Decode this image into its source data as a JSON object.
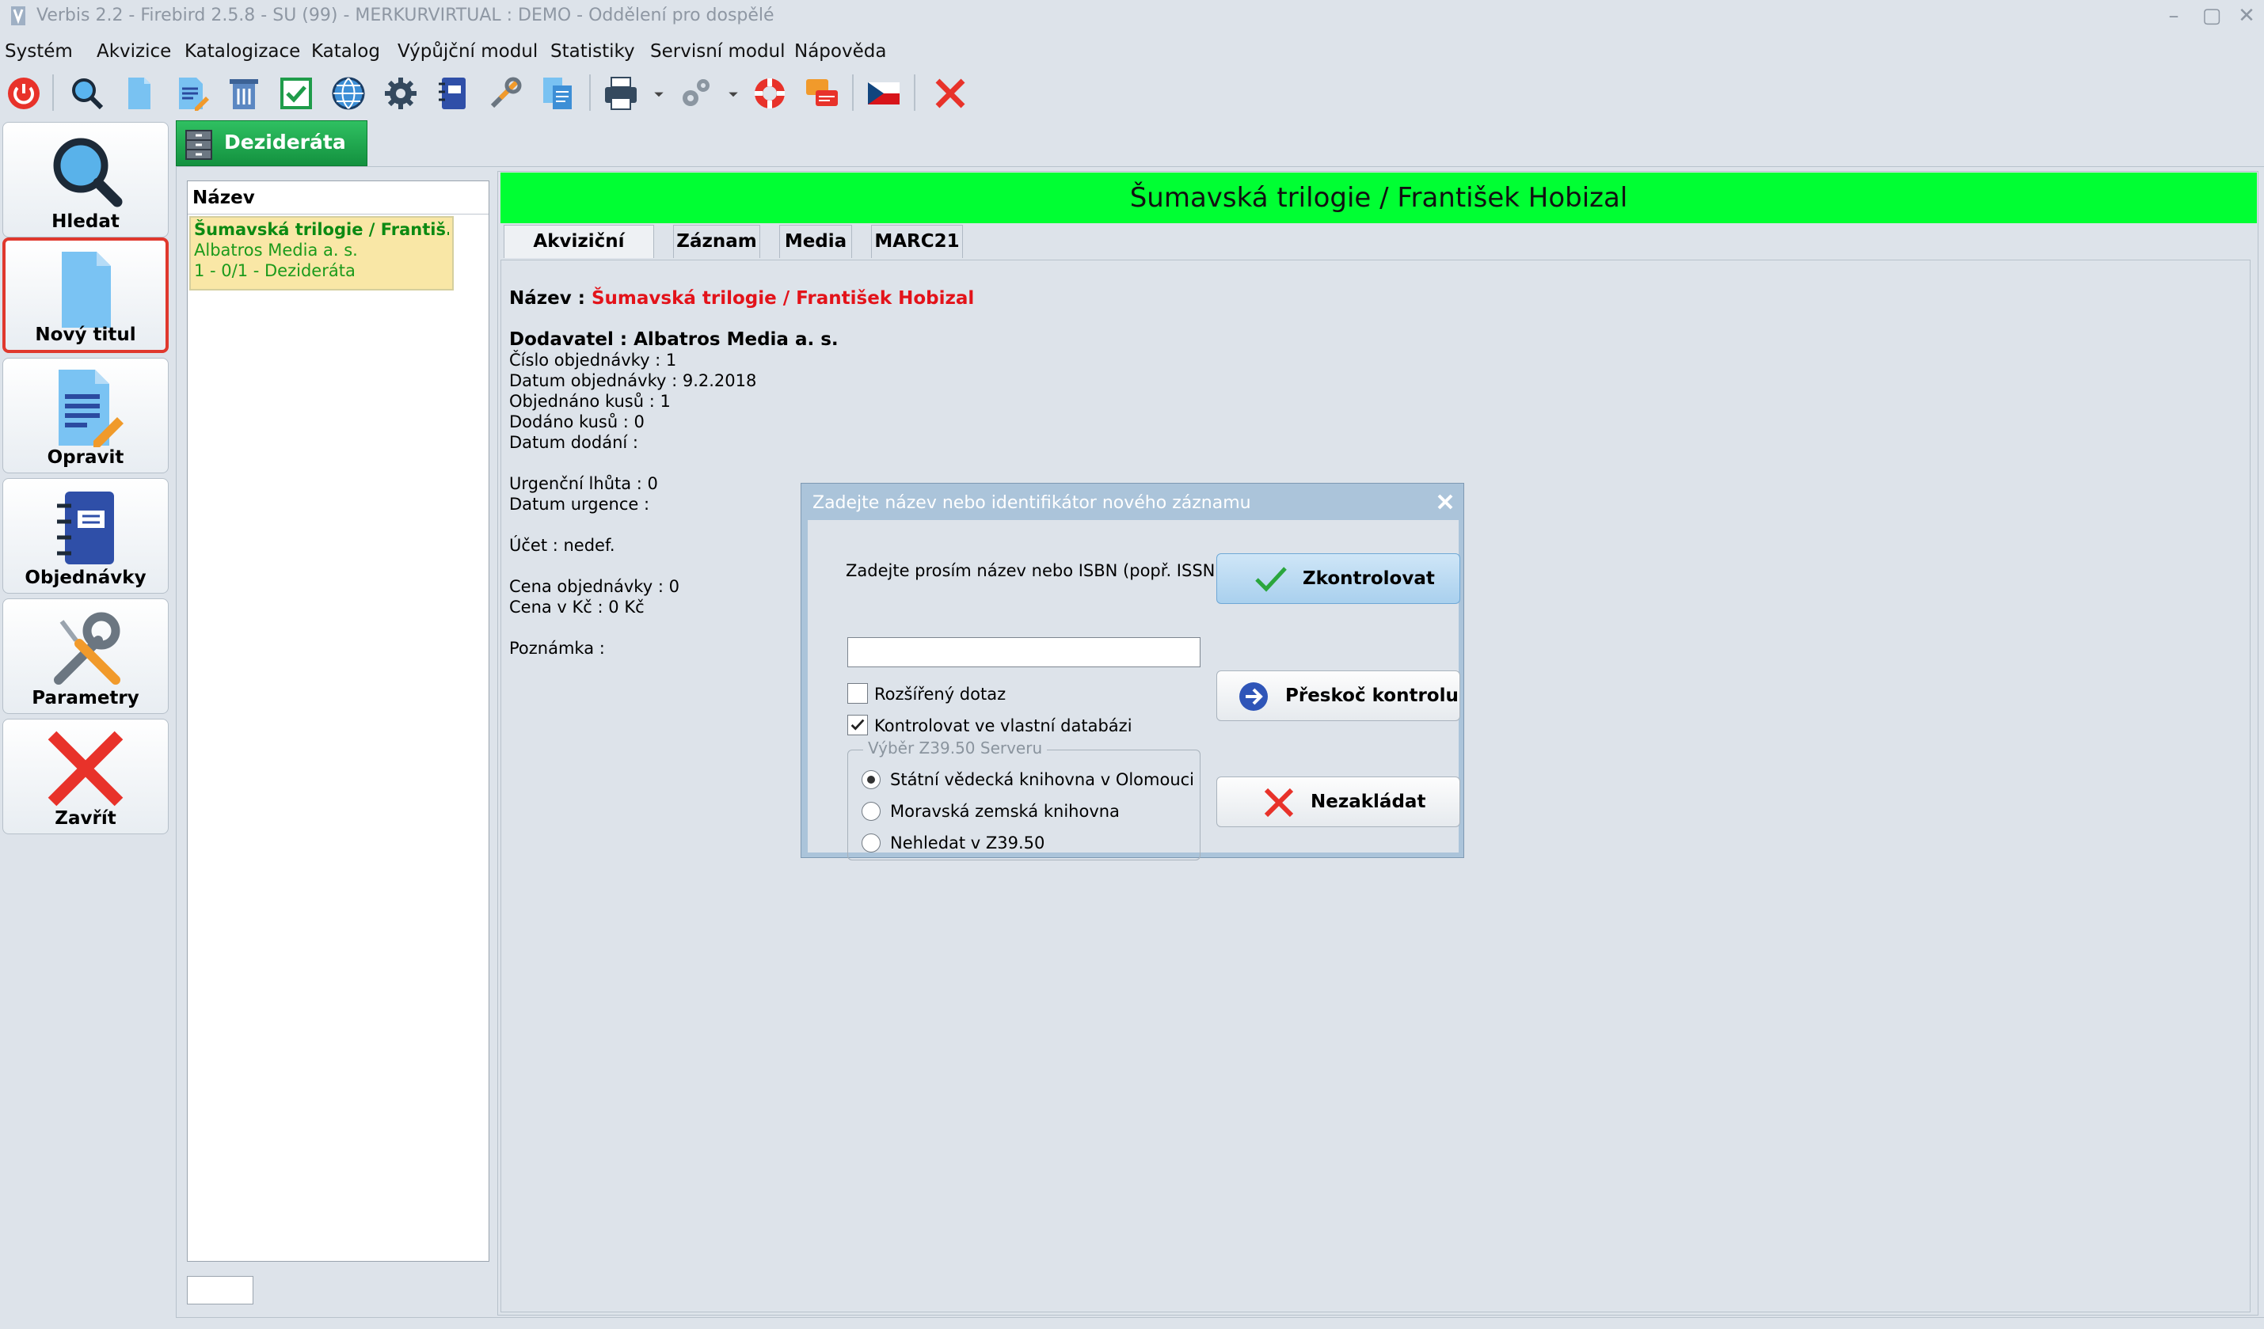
{
  "window": {
    "title": "Verbis 2.2 - Firebird 2.5.8 - SU (99) - MERKURVIRTUAL : DEMO - Oddělení pro dospělé"
  },
  "menu": [
    "Systém",
    "Akvizice",
    "Katalogizace",
    "Katalog",
    "Výpůjční modul",
    "Statistiky",
    "Servisní modul",
    "Nápověda"
  ],
  "sidebar": {
    "items": [
      {
        "label": "Hledat",
        "icon": "magnifier-icon",
        "selected": false
      },
      {
        "label": "Nový titul",
        "icon": "blank-document-icon",
        "selected": true
      },
      {
        "label": "Opravit",
        "icon": "edit-document-icon",
        "selected": false
      },
      {
        "label": "Objednávky",
        "icon": "order-book-icon",
        "selected": false
      },
      {
        "label": "Parametry",
        "icon": "wrench-screwdriver-icon",
        "selected": false
      },
      {
        "label": "Zavřít",
        "icon": "close-x-icon",
        "selected": false
      }
    ]
  },
  "module_tab": {
    "label": "Dezideráta",
    "icon": "cabinet-icon"
  },
  "list": {
    "header": "Název",
    "items": [
      {
        "line1": "Šumavská trilogie / Františ...",
        "line2": "Albatros Media a. s.",
        "line3": "1 - 0/1 - Dezideráta"
      }
    ]
  },
  "record": {
    "banner_title": "Šumavská trilogie / František Hobizal",
    "tabs": [
      "Akviziční údaje",
      "Záznam",
      "Media",
      "MARC21"
    ],
    "active_tab": "Akviziční údaje",
    "name_label": "Název : ",
    "name_value": "Šumavská trilogie / František Hobizal",
    "supplier": "Dodavatel : Albatros Media a. s.",
    "order_number": "Číslo objednávky : 1",
    "order_date": "Datum objednávky : 9.2.2018",
    "ordered_count": "Objednáno kusů : 1",
    "delivered_count": "Dodáno kusů : 0",
    "delivery_date": "Datum dodání :",
    "urgency_period": "Urgenční lhůta : 0",
    "urgency_date": "Datum urgence :",
    "account": "Účet : nedef.",
    "order_price": "Cena objednávky : 0",
    "price_czk": "Cena v Kč : 0 Kč",
    "note": "Poznámka :"
  },
  "dialog": {
    "title": "Zadejte název nebo identifikátor nového záznamu",
    "prompt": "Zadejte prosím název nebo ISBN (popř. ISSN)",
    "input_value": "",
    "extended_query": {
      "label": "Rozšířený dotaz",
      "checked": false
    },
    "check_own_db": {
      "label": "Kontrolovat ve vlastní databázi",
      "checked": true
    },
    "server_group": "Výběr Z39.50 Serveru",
    "servers": [
      {
        "label": "Státní vědecká knihovna v Olomouci",
        "selected": true
      },
      {
        "label": "Moravská zemská knihovna",
        "selected": false
      },
      {
        "label": "Nehledat v Z39.50",
        "selected": false
      }
    ],
    "btn_check": "Zkontrolovat",
    "btn_skip": "Přeskoč kontrolu",
    "btn_cancel": "Nezakládat"
  },
  "colors": {
    "banner": "#00ff33",
    "tab_green": "#13913f",
    "selected_border": "#e0382d",
    "name_red": "#e3131a",
    "list_highlight": "#f9e7a6"
  }
}
